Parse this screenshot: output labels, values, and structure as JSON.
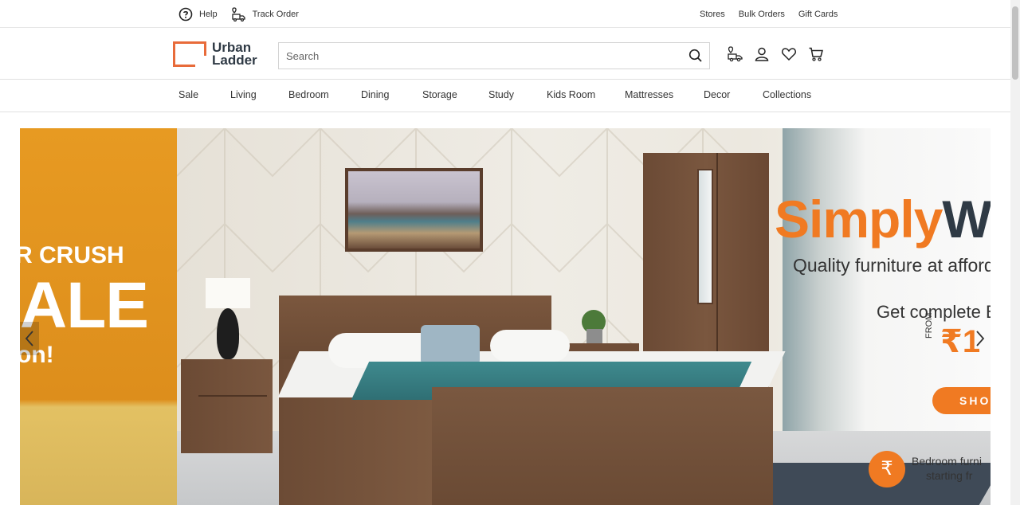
{
  "topbar": {
    "help": "Help",
    "track_order": "Track Order",
    "links": [
      "Stores",
      "Bulk Orders",
      "Gift Cards"
    ]
  },
  "header": {
    "logo_line1": "Urban",
    "logo_line2": "Ladder",
    "search_placeholder": "Search",
    "icons": [
      "delivery-truck-icon",
      "user-icon",
      "heart-icon",
      "cart-icon"
    ]
  },
  "categories": [
    "Sale",
    "Living",
    "Bedroom",
    "Dining",
    "Storage",
    "Study",
    "Kids Room",
    "Mattresses",
    "Decor",
    "Collections"
  ],
  "hero": {
    "prev_slide": {
      "line1": "R CRUSH",
      "line2": "ALE",
      "line3": "on!"
    },
    "promo": {
      "brand_part1": "Simply",
      "brand_part2": "W",
      "tagline": "Quality furniture at afford",
      "offer": "Get complete B",
      "from_label": "FROM",
      "price": "₹1",
      "shop_button": "SHO",
      "badge_symbol": "₹",
      "bedroom_line": "Bedroom furni",
      "starting_line": "starting fr"
    }
  },
  "colors": {
    "brand_orange": "#f07a22",
    "brand_dark": "#2f3a45",
    "prev_slide_bg": "#e79a22"
  }
}
